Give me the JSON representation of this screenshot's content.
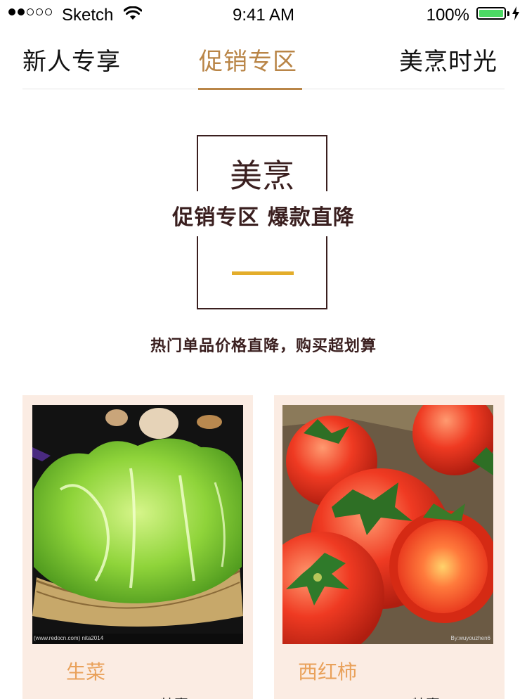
{
  "status_bar": {
    "carrier": "Sketch",
    "time": "9:41 AM",
    "battery_percent": "100%"
  },
  "tabs": [
    {
      "label": "新人专享",
      "active": false
    },
    {
      "label": "促销专区",
      "active": true
    },
    {
      "label": "美烹时光",
      "active": false
    }
  ],
  "banner": {
    "title": "美烹",
    "subtitle": "促销专区 爆款直降",
    "tagline": "热门单品价格直降，购买超划算"
  },
  "products": [
    {
      "name": "生菜",
      "watermark": "(www.redocn.com)   nita2014",
      "extra": "特惠",
      "image": "lettuce-photo"
    },
    {
      "name": "西红柿",
      "watermark": "By:wuyouzhen6",
      "extra": "特惠",
      "image": "tomato-photo"
    }
  ],
  "colors": {
    "accent": "#b98547",
    "dark_brown": "#3a1f1f",
    "gold_bar": "#e3ad2b",
    "card_bg": "#fbece3",
    "product_name": "#e9a15a"
  }
}
